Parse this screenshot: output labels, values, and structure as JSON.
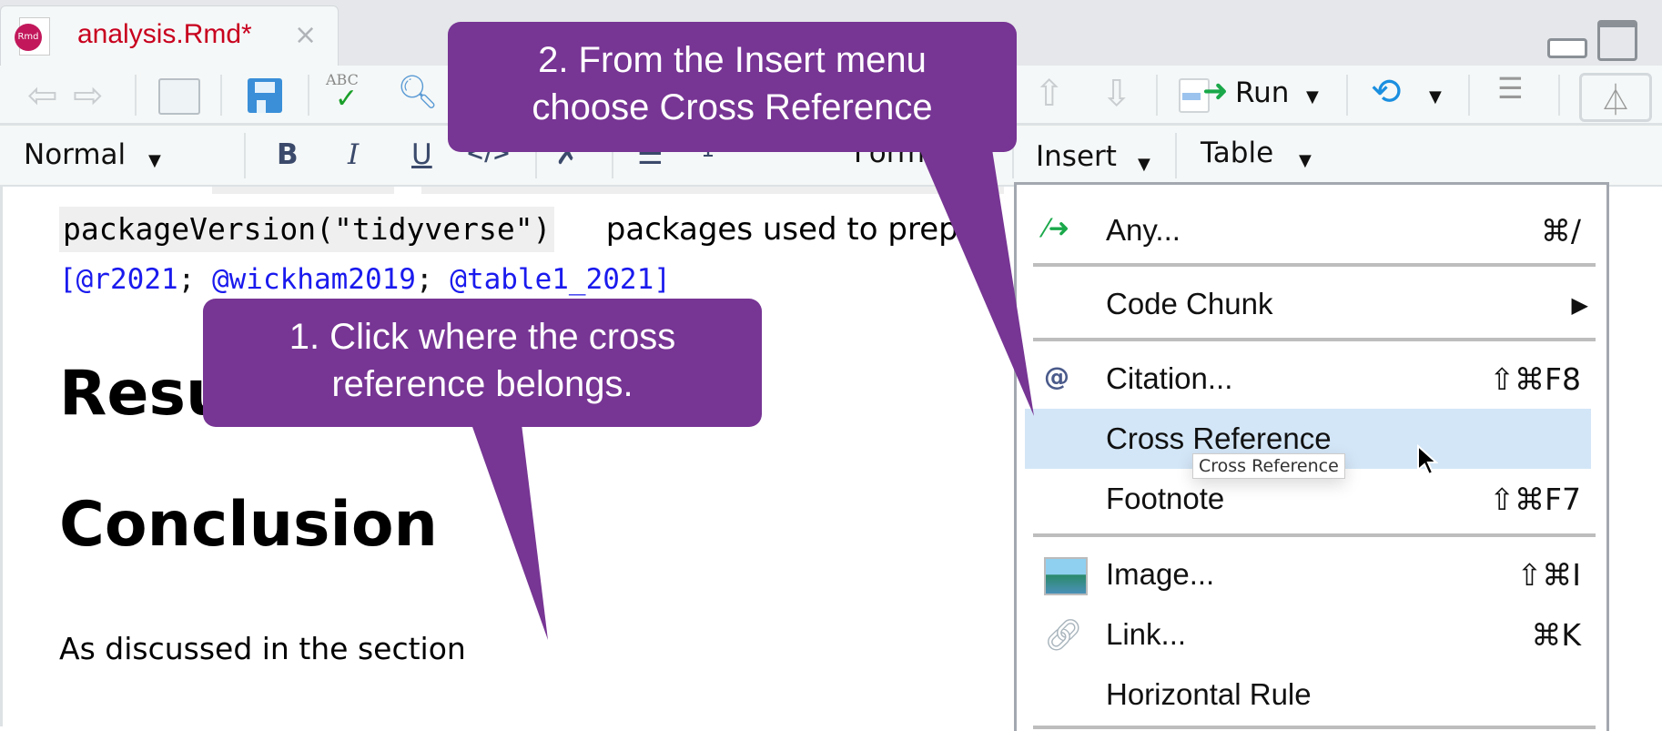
{
  "tab": {
    "title": "analysis.Rmd*",
    "icon_label": "Rmd",
    "close": "×"
  },
  "toolbar": {
    "run_label": "Run",
    "icons": [
      "back-icon",
      "forward-icon",
      "popout-icon",
      "save-icon",
      "spellcheck-icon",
      "search-icon",
      "up-arrow-icon",
      "down-arrow-icon",
      "run-icon",
      "publish-icon",
      "outline-icon",
      "visual-editor-icon"
    ],
    "spellcheck_text": "ABC"
  },
  "format_bar": {
    "style_label": "Normal",
    "bold": "B",
    "italic": "I",
    "underline": "U",
    "code": "</>",
    "format_label": "Format",
    "insert_label": "Insert",
    "table_label": "Table"
  },
  "document": {
    "code_line": "packageVersion(\"tidyverse\")",
    "line_rest": " packages used to prep",
    "citations": [
      {
        "text": "[@r2021"
      },
      {
        "text": "; "
      },
      {
        "text": "@wickham2019"
      },
      {
        "text": "; "
      },
      {
        "text": "@table1_2021]"
      }
    ],
    "heading_results": "Results",
    "heading_conclusion": "Conclusion",
    "paragraph": "As discussed in the section"
  },
  "insert_menu": {
    "items": [
      {
        "label": "Any...",
        "shortcut": "⌘/",
        "icon": "insert-any-icon"
      },
      {
        "label": "Code Chunk",
        "shortcut": "▶",
        "icon": ""
      },
      {
        "label": "Citation...",
        "shortcut": "⇧⌘F8",
        "icon": "at-icon"
      },
      {
        "label": "Cross Reference",
        "shortcut": "",
        "icon": "",
        "highlighted": true
      },
      {
        "label": "Footnote",
        "shortcut": "⇧⌘F7",
        "icon": ""
      },
      {
        "label": "Image...",
        "shortcut": "⇧⌘I",
        "icon": "image-icon"
      },
      {
        "label": "Link...",
        "shortcut": "⌘K",
        "icon": "link-icon"
      },
      {
        "label": "Horizontal Rule",
        "shortcut": "",
        "icon": ""
      }
    ],
    "tooltip": "Cross Reference",
    "highlight_color": "#d3e6f7"
  },
  "callouts": [
    {
      "line1": "1. Click where the cross",
      "line2": "reference belongs."
    },
    {
      "line1": "2. From the Insert menu",
      "line2": "choose Cross Reference"
    }
  ],
  "colors": {
    "callout": "#773594",
    "tab_title": "#c8001e",
    "citation": "#1a1aee"
  }
}
